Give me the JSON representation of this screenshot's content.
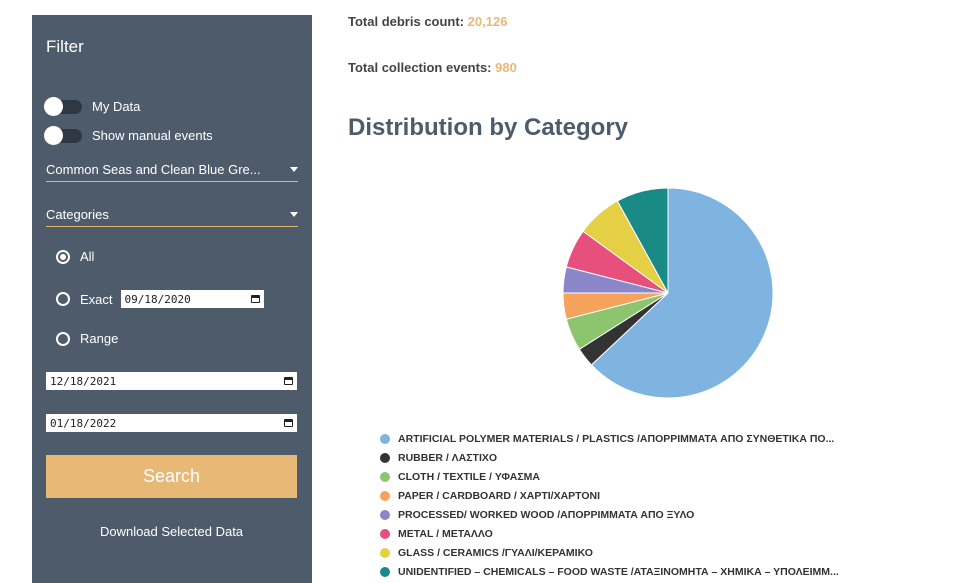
{
  "sidebar": {
    "title": "Filter",
    "toggles": [
      {
        "label": "My Data",
        "on": false
      },
      {
        "label": "Show manual events",
        "on": false
      }
    ],
    "project_select": "Common Seas and Clean Blue Gre...",
    "categories_select": "Categories",
    "radios": [
      {
        "label": "All",
        "checked": true
      },
      {
        "label": "Exact",
        "checked": false
      },
      {
        "label": "Range",
        "checked": false
      }
    ],
    "exact_date": "09/18/2020",
    "range_from": "12/18/2021",
    "range_to": "01/18/2022",
    "search_label": "Search",
    "download_label": "Download Selected Data"
  },
  "stats": {
    "debris_label": "Total debris count:",
    "debris_value": "20,126",
    "events_label": "Total collection events:",
    "events_value": "980"
  },
  "heading": "Distribution by Category",
  "chart_data": {
    "type": "pie",
    "title": "",
    "slices": [
      {
        "label": "ARTIFICIAL POLYMER MATERIALS / PLASTICS /ΑΠΟΡΡΙΜΜΑΤΑ ΑΠΟ ΣΥΝΘΕΤΙΚΑ ΠΟ...",
        "value": 63.0,
        "color": "#7fb3e0"
      },
      {
        "label": "RUBBER / ΛΑΣΤΙΧΟ",
        "value": 3.0,
        "color": "#333333"
      },
      {
        "label": "CLOTH / TEXTILE / ΥΦΑΣΜΑ",
        "value": 5.0,
        "color": "#8cc56d"
      },
      {
        "label": "PAPER / CARDBOARD / ΧΑΡΤΙ/ΧΑΡΤΟΝΙ",
        "value": 4.0,
        "color": "#f5a25d"
      },
      {
        "label": "PROCESSED/ WORKED WOOD /ΑΠΟΡΡΙΜΜΑΤΑ ΑΠΟ ΞΥΛΟ",
        "value": 4.0,
        "color": "#8b86c9"
      },
      {
        "label": "METAL / ΜΕΤΑΛΛΟ",
        "value": 6.0,
        "color": "#e7507c"
      },
      {
        "label": "GLASS / CERAMICS /ΓΥΑΛΙ/ΚΕΡΑΜΙΚΟ",
        "value": 7.0,
        "color": "#e4cf45"
      },
      {
        "label": "UNIDENTIFIED – CHEMICALS – FOOD WASTE /ΑΤΑΞΙΝΟΜΗΤΑ – ΧΗΜΙΚΑ – ΥΠΟΛΕΙΜΜ...",
        "value": 8.0,
        "color": "#1a8a87"
      }
    ]
  }
}
